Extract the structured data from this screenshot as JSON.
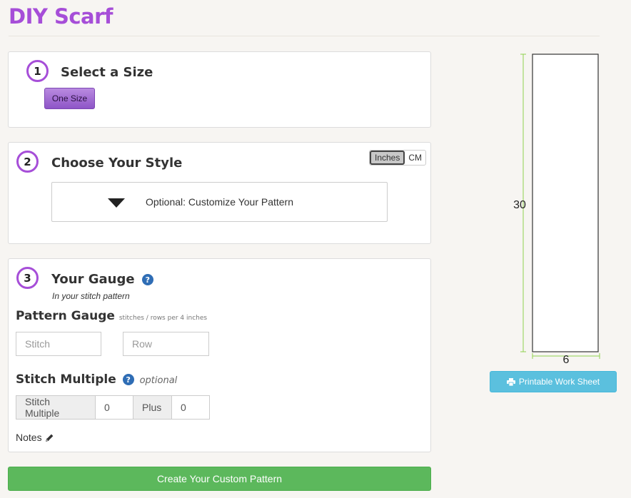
{
  "page": {
    "title": "DIY Scarf"
  },
  "step1": {
    "number": "1",
    "heading": "Select a Size",
    "size_button": "One Size"
  },
  "step2": {
    "number": "2",
    "heading": "Choose Your Style",
    "units": {
      "inches": "Inches",
      "cm": "CM",
      "selected": "Inches"
    },
    "customize_label": "Optional: Customize Your Pattern"
  },
  "step3": {
    "number": "3",
    "heading": "Your Gauge",
    "help": "?",
    "subtitle": "In your stitch pattern",
    "pattern_gauge": {
      "heading": "Pattern Gauge",
      "note": "stitches / rows per 4 inches",
      "stitch_placeholder": "Stitch",
      "row_placeholder": "Row"
    },
    "stitch_multiple": {
      "heading": "Stitch Multiple",
      "help": "?",
      "optional": "optional",
      "label": "Stitch Multiple",
      "value": "0",
      "plus_label": "Plus",
      "plus_value": "0"
    },
    "notes_label": "Notes"
  },
  "create_button": "Create Your Custom Pattern",
  "diagram": {
    "height_label": "30",
    "width_label": "6",
    "line_color": "#8fd14f"
  },
  "print_button": "Printable Work Sheet",
  "colors": {
    "brand": "#a64ed8",
    "create": "#5cb85c",
    "print": "#5bc0de"
  }
}
